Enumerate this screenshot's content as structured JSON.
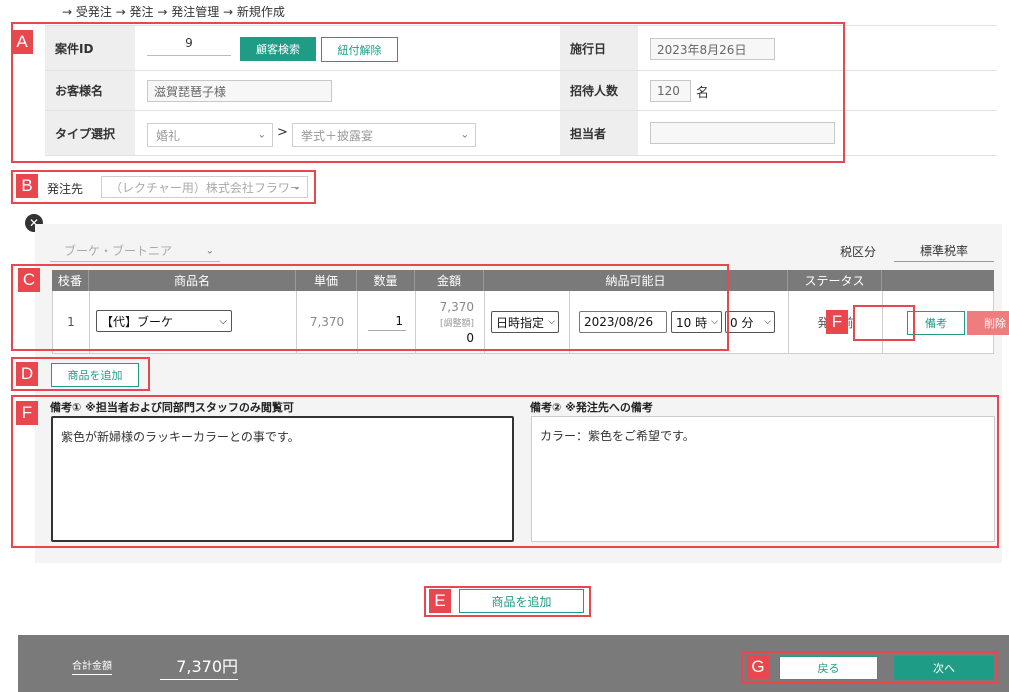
{
  "breadcrumb": "→ 受発注 → 発注 → 発注管理 → 新規作成",
  "annotations": {
    "a": "A",
    "b": "B",
    "c": "C",
    "d": "D",
    "e": "E",
    "f1": "F",
    "f2": "F",
    "g": "G"
  },
  "form": {
    "case_id_label": "案件ID",
    "case_id_value": "9",
    "customer_search_label": "顧客検索",
    "unlink_label": "紐付解除",
    "customer_name_label": "お客様名",
    "customer_name_value": "滋賀琵琶子様",
    "type_label": "タイプ選択",
    "type_value": "婚礼",
    "type_separator": ">",
    "subtype_value": "挙式＋披露宴",
    "event_date_label": "施行日",
    "event_date_value": "2023年8月26日",
    "guest_count_label": "招待人数",
    "guest_count_value": "120",
    "guest_count_unit": "名",
    "staff_label": "担当者",
    "staff_value": ""
  },
  "supplier": {
    "label": "発注先",
    "value": "（レクチャー用）株式会社フラワー"
  },
  "order": {
    "category_value": "ブーケ・ブートニア",
    "tax_label": "税区分",
    "tax_value": "標準税率",
    "columns": [
      "枝番",
      "商品名",
      "単価",
      "数量",
      "金額",
      "納品可能日",
      "ステータス",
      ""
    ],
    "row": {
      "branch_no": "1",
      "product": "【代】ブーケ",
      "unit_price": "7,370",
      "quantity": "1",
      "amount": "7,370",
      "adjust_label": "[調整額]",
      "adjust_value": "0",
      "date_mode": "日時指定",
      "date": "2023/08/26",
      "hour": "10 時",
      "minute": "0 分",
      "status": "発注前",
      "note_button": "備考",
      "delete_button": "削除"
    },
    "add_product_small": "商品を追加",
    "note1_label": "備考① ※担当者および同部門スタッフのみ閲覧可",
    "note1_text": "紫色が新婦様のラッキーカラーとの事です。",
    "note2_label": "備考② ※発注先への備考",
    "note2_text": "カラー：紫色をご希望です。"
  },
  "add_product_main": "商品を追加",
  "footer": {
    "total_label": "合計金額",
    "total_value": "7,370円",
    "back_label": "戻る",
    "next_label": "次へ"
  },
  "colors": {
    "accent": "#1e9c86",
    "delete": "#ef7d7d",
    "annotation": "#e8474f",
    "footer": "#7a7a7a"
  }
}
